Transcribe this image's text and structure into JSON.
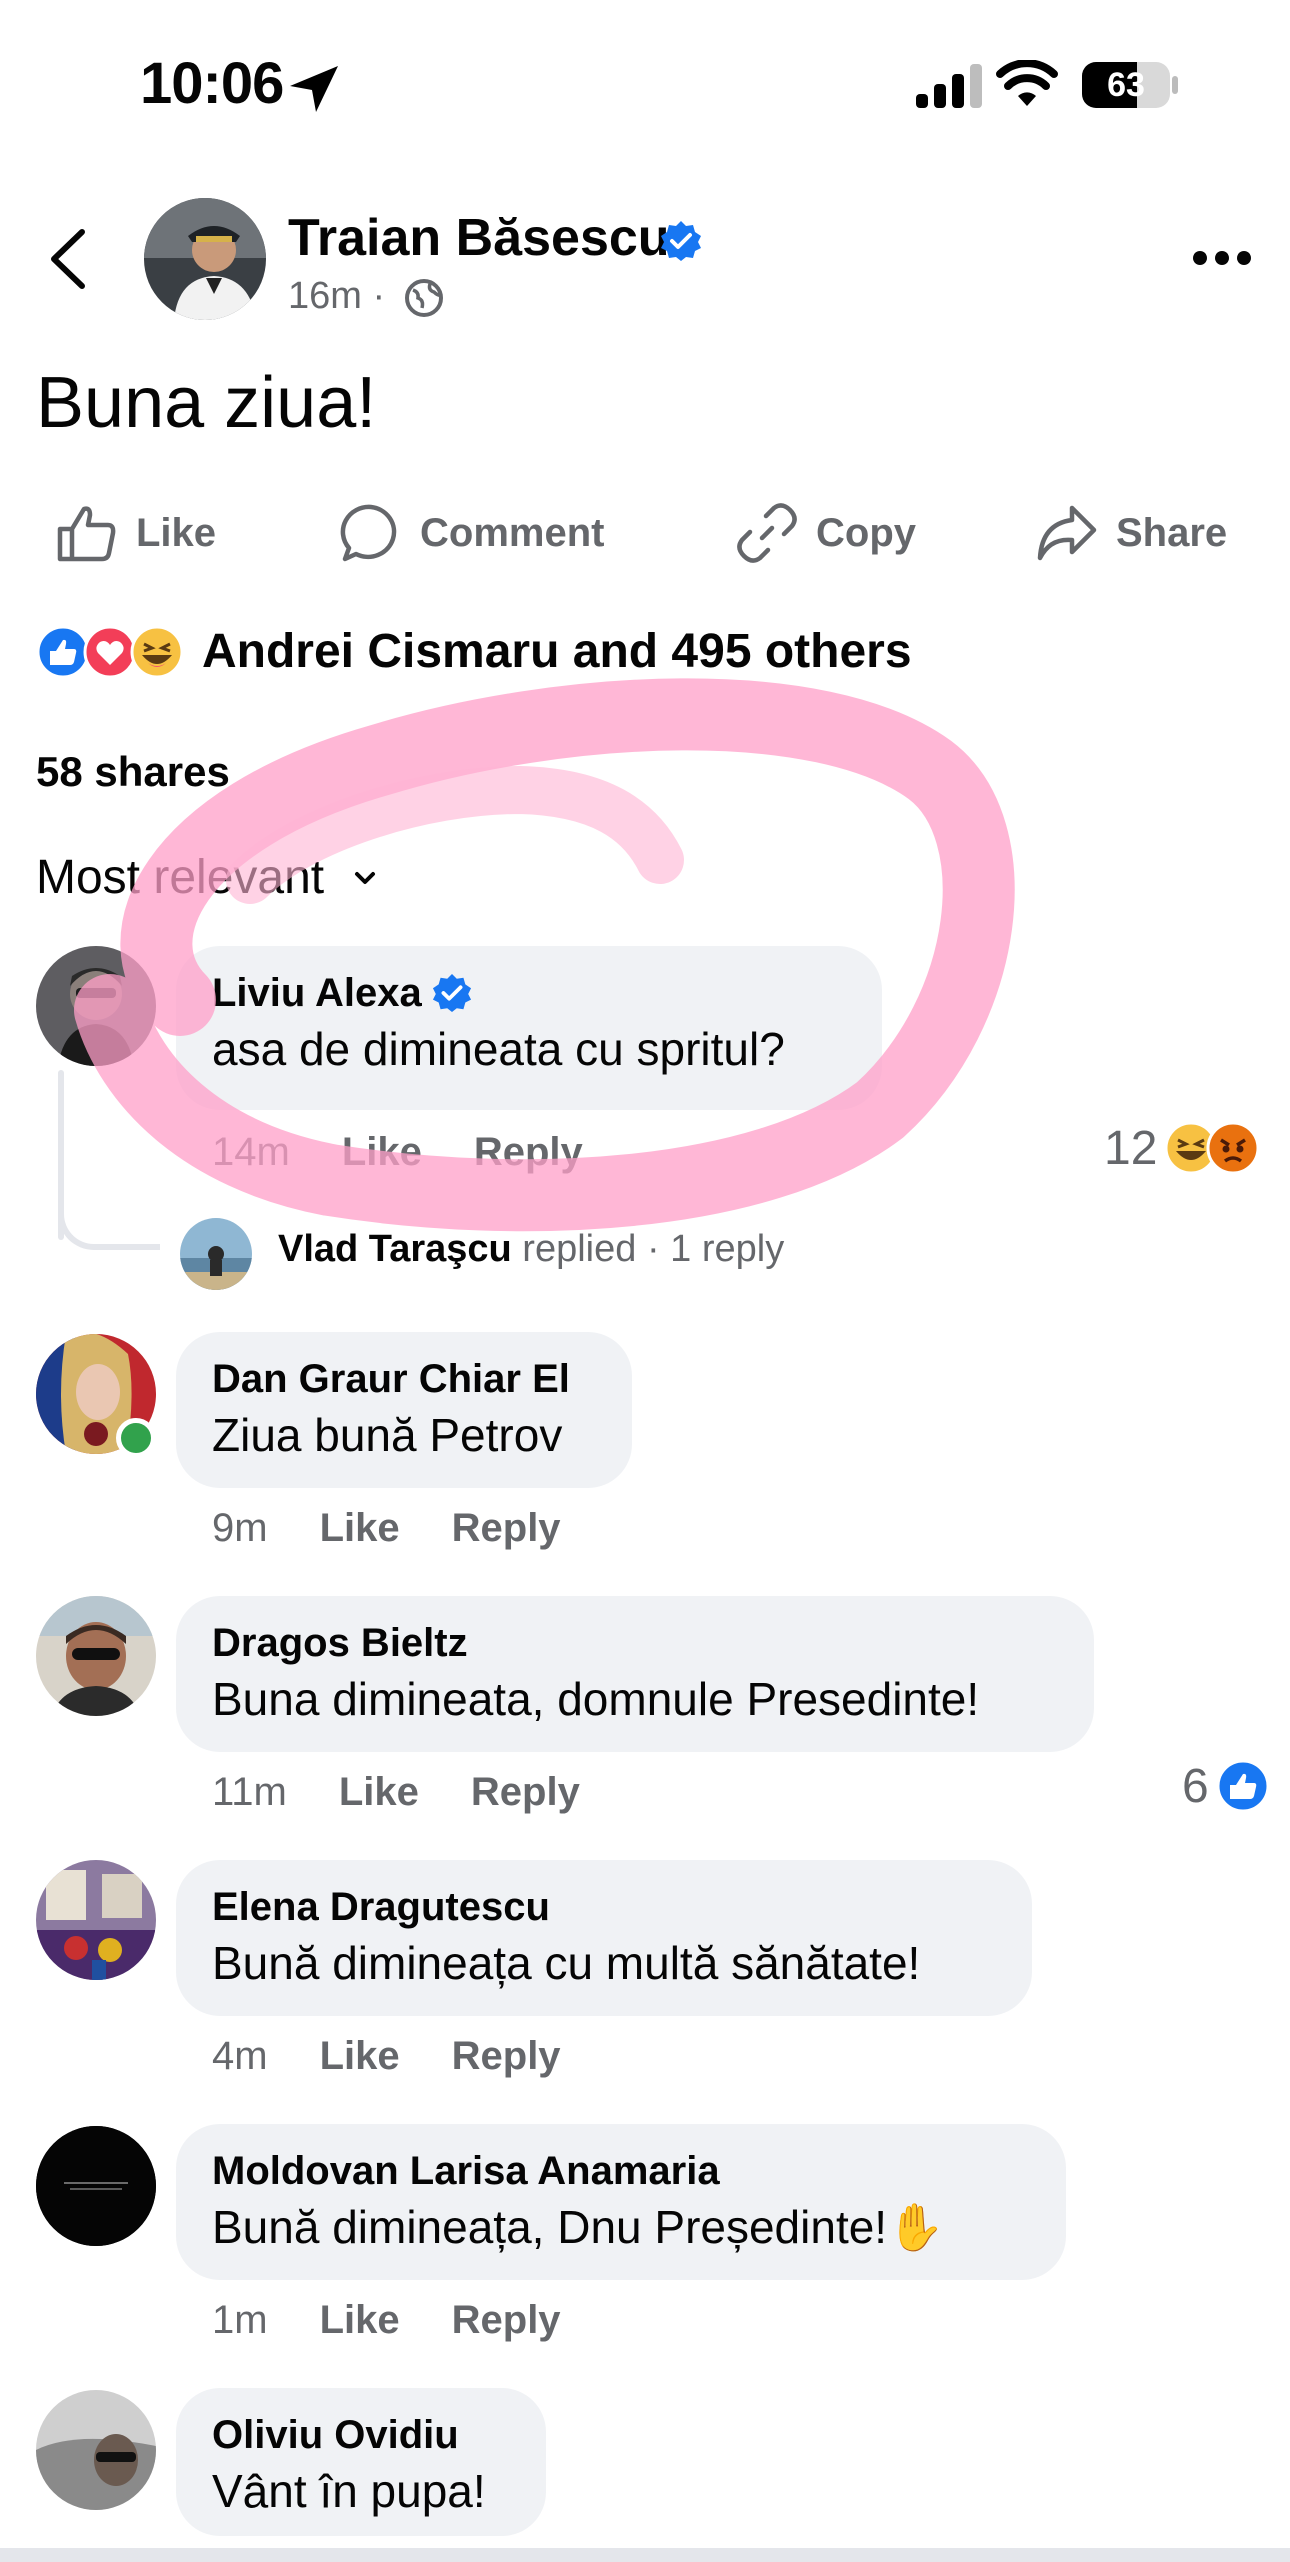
{
  "status_bar": {
    "time": "10:06",
    "battery": "63",
    "battery_level_percent": 63
  },
  "post": {
    "author": "Traian Băsescu",
    "time": "16m",
    "text": "Buna ziua!",
    "actions": {
      "like": "Like",
      "comment": "Comment",
      "copy": "Copy",
      "share": "Share"
    },
    "reactions_summary": "Andrei Cismaru and 495 others",
    "shares": "58 shares",
    "sort_label": "Most relevant"
  },
  "comments": [
    {
      "name": "Liviu Alexa",
      "verified": true,
      "text": "asa de dimineata cu spritul?",
      "time": "14m",
      "like": "Like",
      "reply": "Reply",
      "reaction_count": "12",
      "reply_preview": {
        "name": "Vlad Taraşcu",
        "verb": "replied",
        "count": "· 1 reply"
      }
    },
    {
      "name": "Dan Graur Chiar El",
      "text": "Ziua bună Petrov",
      "time": "9m",
      "like": "Like",
      "reply": "Reply",
      "online": true
    },
    {
      "name": "Dragos Bieltz",
      "text": "Buna dimineata, domnule Presedinte!",
      "time": "11m",
      "like": "Like",
      "reply": "Reply",
      "reaction_count": "6"
    },
    {
      "name": "Elena Dragutescu",
      "text": "Bună dimineața cu multă sănătate!",
      "time": "4m",
      "like": "Like",
      "reply": "Reply"
    },
    {
      "name": "Moldovan Larisa Anamaria",
      "text": "Bună dimineața, Dnu Președinte!✋",
      "time": "1m",
      "like": "Like",
      "reply": "Reply"
    },
    {
      "name": "Oliviu Ovidiu",
      "text": "Vânt în pupa!"
    }
  ],
  "colors": {
    "accent_blue": "#1877f2",
    "muted_text": "#65676b",
    "bubble_bg": "#f0f2f5",
    "annotation_pink": "#ff9fc8",
    "online_green": "#31a24c"
  },
  "icons": [
    "location-arrow-icon",
    "signal-icon",
    "wifi-icon",
    "battery-icon",
    "back-chevron-icon",
    "verified-badge-icon",
    "globe-icon",
    "more-icon",
    "like-icon",
    "comment-icon",
    "copy-link-icon",
    "share-icon",
    "like-reaction-icon",
    "love-reaction-icon",
    "haha-reaction-icon",
    "angry-reaction-icon",
    "chevron-down-icon"
  ]
}
